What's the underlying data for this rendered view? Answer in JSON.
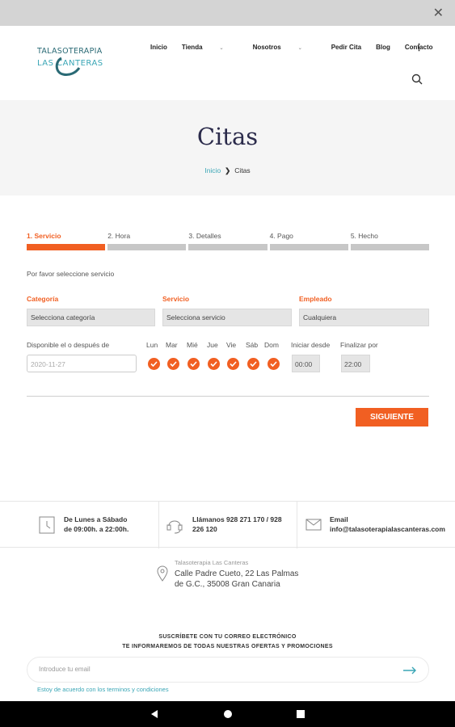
{
  "topbar": {
    "close": "✕"
  },
  "logo": {
    "line1": "TALASOTERAPIA",
    "line2": "LAS CANTERAS"
  },
  "nav": {
    "items": [
      "Inicio",
      "Tienda",
      "Nosotros",
      "Pedir Cita",
      "Blog",
      "Contacto"
    ],
    "more": "⋮"
  },
  "page": {
    "title": "Citas",
    "breadcrumb_home": "Inicio",
    "breadcrumb_sep": "❯",
    "breadcrumb_current": "Citas"
  },
  "steps": [
    "1. Servicio",
    "2. Hora",
    "3. Detalles",
    "4. Pago",
    "5. Hecho"
  ],
  "form": {
    "prompt": "Por favor seleccione servicio",
    "category_label": "Categoría",
    "category_value": "Selecciona categoría",
    "service_label": "Servicio",
    "service_value": "Selecciona servicio",
    "employee_label": "Empleado",
    "employee_value": "Cualquiera",
    "date_label": "Disponible el o después de",
    "date_placeholder": "2020-11-27",
    "days": [
      "Lun",
      "Mar",
      "Mié",
      "Jue",
      "Vie",
      "Sáb",
      "Dom"
    ],
    "start_label": "Iniciar desde",
    "start_value": "00:00",
    "end_label": "Finalizar por",
    "end_value": "22:00",
    "next_button": "SIGUIENTE"
  },
  "info": {
    "hours_line1": "De Lunes a Sábado",
    "hours_line2": "de 09:00h. a 22:00h.",
    "phone_line1": "Llámanos 928 271 170 / 928",
    "phone_line2": "226 120",
    "email_line1": "Email",
    "email_line2": "info@talasoterapialascanteras.com"
  },
  "address": {
    "name": "Talasoterapia Las Canteras",
    "line1": "Calle Padre Cueto, 22 Las Palmas",
    "line2": "de G.C., 35008 Gran Canaria"
  },
  "newsletter": {
    "line1": "SUSCRÍBETE CON TU CORREO ELECTRÓNICO",
    "line2": "TE INFORMAREMOS DE TODAS NUESTRAS OFERTAS Y PROMOCIONES",
    "placeholder": "Introduce tu email",
    "terms": "Estoy de acuerdo con los terminos y condiciones"
  },
  "colors": {
    "accent": "#f15f22",
    "teal": "#3aa6b6"
  }
}
